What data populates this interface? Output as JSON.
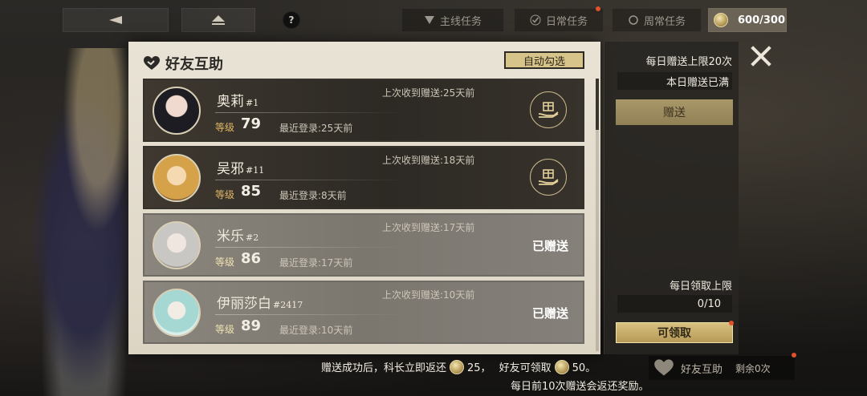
{
  "topbar": {
    "tabs": [
      {
        "label": "主线任务"
      },
      {
        "label": "日常任务"
      },
      {
        "label": "周常任务"
      }
    ],
    "points": "600/300"
  },
  "dialog": {
    "title": "好友互助",
    "auto_select_label": "自动勾选",
    "friends": [
      {
        "name": "奥莉",
        "num": "#1",
        "level_label": "等级",
        "level": "79",
        "last_login": "最近登录:25天前",
        "last_received": "上次收到赠送:25天前",
        "status": "gift"
      },
      {
        "name": "吴邪",
        "num": "#11",
        "level_label": "等级",
        "level": "85",
        "last_login": "最近登录:8天前",
        "last_received": "上次收到赠送:18天前",
        "status": "gift"
      },
      {
        "name": "米乐",
        "num": "#2",
        "level_label": "等级",
        "level": "86",
        "last_login": "最近登录:17天前",
        "last_received": "上次收到赠送:17天前",
        "status": "已赠送"
      },
      {
        "name": "伊丽莎白",
        "num": "#2417",
        "level_label": "等级",
        "level": "89",
        "last_login": "最近登录:10天前",
        "last_received": "上次收到赠送:10天前",
        "status": "已赠送"
      }
    ]
  },
  "side": {
    "daily_give_limit": "每日赠送上限20次",
    "today_full": "本日赠送已满",
    "give_label": "赠送",
    "daily_claim_limit": "每日领取上限",
    "claim_count": "0/10",
    "claim_label": "可领取"
  },
  "bottom": {
    "note_a": "赠送成功后，科长立即返还",
    "note_a_value": "25，",
    "note_b": "好友可领取",
    "note_b_value": "50。",
    "note2": "每日前10次赠送会返还奖励。",
    "friend_tab": "好友互助",
    "remaining": "剩余0次"
  },
  "colors": {
    "accent": "#d7c48a",
    "dialog_bg": "#e9e3d6",
    "reddot": "#e2502c"
  }
}
